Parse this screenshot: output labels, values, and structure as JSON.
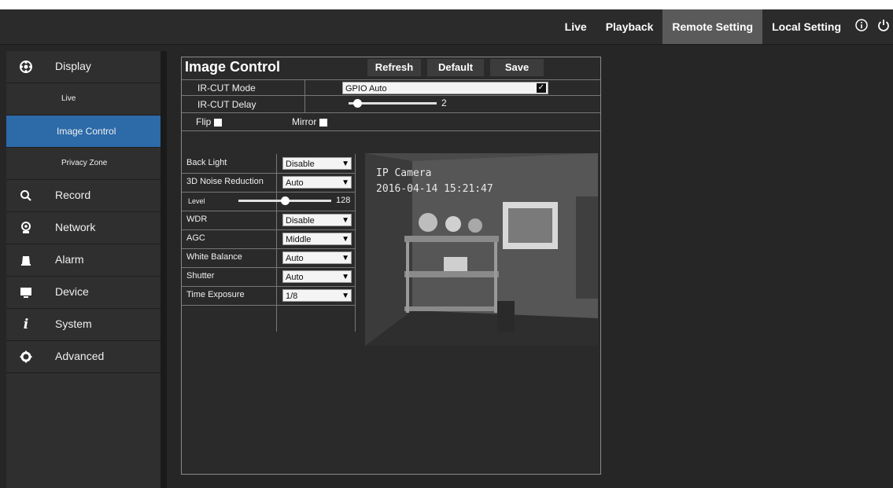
{
  "nav": {
    "items": [
      {
        "label": "Live",
        "active": false
      },
      {
        "label": "Playback",
        "active": false
      },
      {
        "label": "Remote Setting",
        "active": true
      },
      {
        "label": "Local Setting",
        "active": false
      }
    ],
    "info_icon": "info-icon",
    "power_icon": "power-icon"
  },
  "sidebar": {
    "display": {
      "label": "Display",
      "icon": "display-icon"
    },
    "subs": [
      {
        "label": "Live",
        "active": false
      },
      {
        "label": "Image Control",
        "active": true
      },
      {
        "label": "Privacy Zone",
        "active": false
      }
    ],
    "items": [
      {
        "label": "Record",
        "icon": "search-icon"
      },
      {
        "label": "Network",
        "icon": "network-icon"
      },
      {
        "label": "Alarm",
        "icon": "alarm-icon"
      },
      {
        "label": "Device",
        "icon": "monitor-icon"
      },
      {
        "label": "System",
        "icon": "info-icon"
      },
      {
        "label": "Advanced",
        "icon": "gear-icon"
      }
    ]
  },
  "panel": {
    "title": "Image Control",
    "buttons": {
      "refresh": "Refresh",
      "default": "Default",
      "save": "Save"
    },
    "ircut_mode": {
      "label": "IR-CUT Mode",
      "value": "GPIO Auto"
    },
    "ircut_delay": {
      "label": "IR-CUT Delay",
      "value": "2",
      "level": 0.1
    },
    "flip": {
      "label": "Flip"
    },
    "mirror": {
      "label": "Mirror"
    },
    "settings": [
      {
        "label": "Back Light",
        "value": "Disable"
      },
      {
        "label": "3D Noise Reduction",
        "value": "Auto"
      },
      {
        "label": "WDR",
        "value": "Disable"
      },
      {
        "label": "AGC",
        "value": "Middle"
      },
      {
        "label": "White Balance",
        "value": "Auto"
      },
      {
        "label": "Shutter",
        "value": "Auto"
      },
      {
        "label": "Time Exposure",
        "value": "1/8"
      }
    ],
    "level": {
      "label": "Level",
      "value": "128",
      "fraction": 0.5
    },
    "preview": {
      "camera_name": "IP Camera",
      "timestamp": "2016-04-14 15:21:47"
    }
  }
}
